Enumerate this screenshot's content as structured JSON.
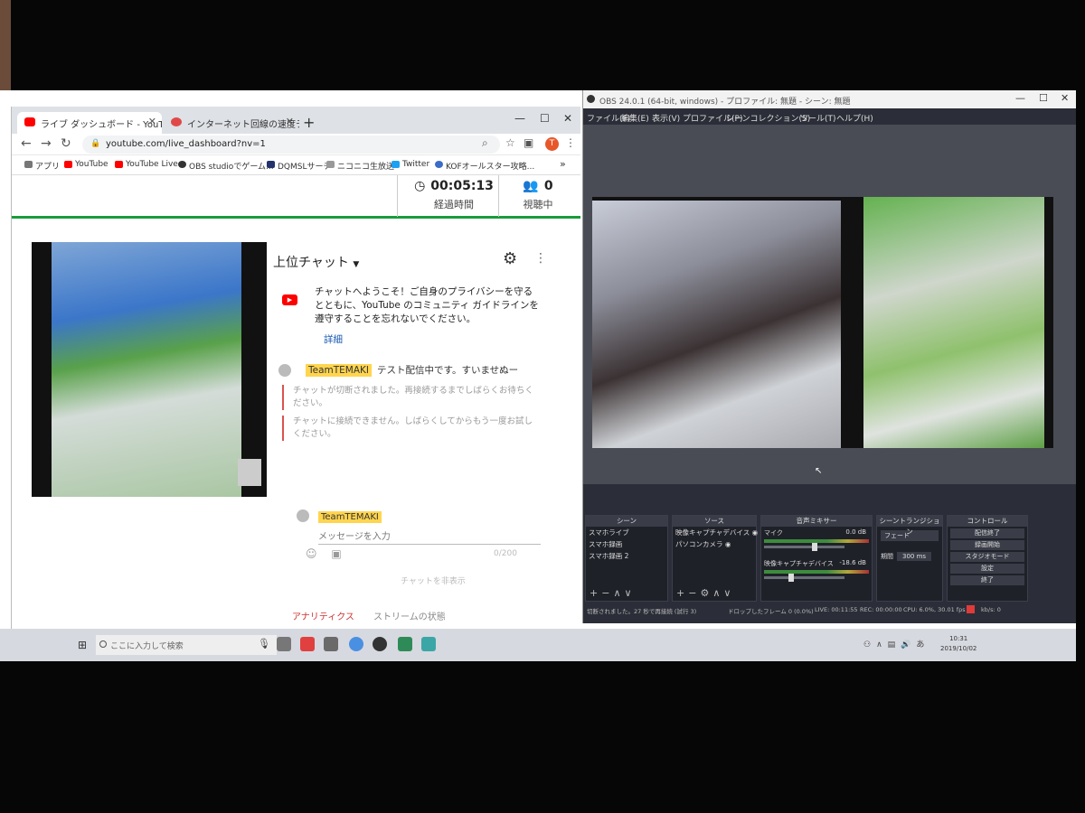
{
  "chrome": {
    "tabs": [
      {
        "title": "ライブ ダッシュボード - YouTube",
        "color": "#ff0000"
      },
      {
        "title": "インターネット回線の速度テスト | Fast",
        "color": "#e04848"
      }
    ],
    "new_tab": "+",
    "url": "youtube.com/live_dashboard?nv=1",
    "profile_initial": "T",
    "bookmarks": [
      {
        "label": "アプリ",
        "color": "#777777"
      },
      {
        "label": "YouTube",
        "color": "#ff0000"
      },
      {
        "label": "YouTube Live",
        "color": "#ff0000"
      },
      {
        "label": "OBS studioでゲーム...",
        "color": "#333333"
      },
      {
        "label": "DQMSLサーチ",
        "color": "#22336b"
      },
      {
        "label": "ニコニコ生放送",
        "color": "#999999"
      },
      {
        "label": "Twitter",
        "color": "#1da1f2"
      },
      {
        "label": "KOFオールスター攻略...",
        "color": "#3b6cc8"
      }
    ]
  },
  "dashboard": {
    "elapsed_value": "00:05:13",
    "elapsed_label": "経過時間",
    "viewers_value": "0",
    "viewers_label": "視聴中"
  },
  "chat": {
    "title": "上位チャット",
    "welcome_text": "チャットへようこそ！ご自身のプライバシーを守るとともに、YouTube のコミュニティ ガイドラインを遵守することを忘れないでください。",
    "welcome_link": "詳細",
    "messages": [
      {
        "author": "TeamTEMAKI",
        "text": "テスト配信中です。すいませぬー"
      }
    ],
    "system_messages": [
      "チャットが切断されました。再接続するまでしばらくお待ちください。",
      "チャットに接続できません。しばらくしてからもう一度お試しください。"
    ],
    "composer_author": "TeamTEMAKI",
    "input_placeholder": "メッセージを入力",
    "char_count": "0/200",
    "popout": "チャットを非表示"
  },
  "bottom_tabs": [
    {
      "label": "アナリティクス",
      "active": true
    },
    {
      "label": "ストリームの状態",
      "active": false
    }
  ],
  "obs": {
    "title": "OBS 24.0.1 (64-bit, windows) - プロファイル: 無題 - シーン: 無題",
    "menu": [
      "ファイル(F)",
      "編集(E)",
      "表示(V)",
      "プロファイル(P)",
      "シーンコレクション(S)",
      "ツール(T)",
      "ヘルプ(H)"
    ],
    "docks": {
      "scenes": {
        "title": "シーン",
        "items": [
          "スマホライブ",
          "スマホ録画",
          "スマホ録画 2"
        ]
      },
      "sources": {
        "title": "ソース",
        "items": [
          "映像キャプチャデバイス",
          "パソコンカメラ"
        ]
      },
      "mixer": {
        "title": "音声ミキサー",
        "channels": [
          {
            "name": "マイク",
            "db": "0.0 dB"
          },
          {
            "name": "映像キャプチャデバイス",
            "db": "-18.6 dB"
          }
        ]
      },
      "transitions": {
        "title": "シーントランジション",
        "type": "フェード",
        "duration_label": "期間",
        "duration_value": "300 ms"
      },
      "controls": {
        "title": "コントロール",
        "buttons": [
          "配信終了",
          "録画開始",
          "スタジオモード",
          "設定",
          "終了"
        ]
      }
    },
    "status": {
      "reconnect": "切断されました。27 秒で再接続 (試行 3)",
      "dropped": "ドロップしたフレーム 0 (0.0%)",
      "live": "LIVE: 00:11:55",
      "rec": "REC: 00:00:00",
      "cpu": "CPU: 6.0%, 30.01 fps",
      "kbps": "kb/s: 0"
    }
  },
  "taskbar": {
    "search_placeholder": "ここに入力して検索",
    "time": "10:31",
    "date": "2019/10/02"
  }
}
